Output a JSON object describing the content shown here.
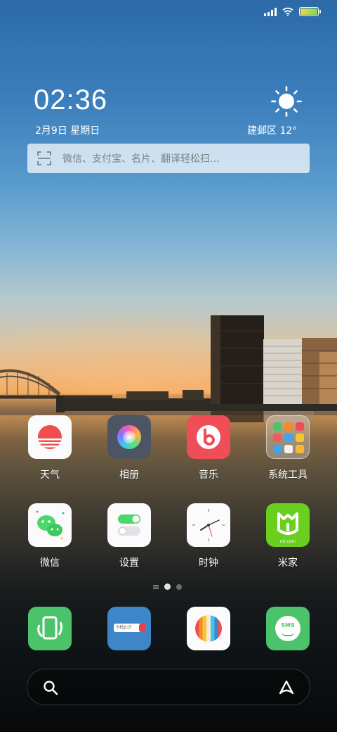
{
  "status_bar": {
    "signal_icon": "cellular-signal-icon",
    "wifi_icon": "wifi-icon",
    "battery_icon": "battery-icon"
  },
  "clock": {
    "time": "02:36",
    "date": "2月9日  星期日"
  },
  "weather": {
    "icon": "sun-icon",
    "location_temp": "建邺区  12°"
  },
  "top_search": {
    "icon": "scan-icon",
    "placeholder": "微信、支付宝、名片、翻译轻松扫..."
  },
  "apps": [
    {
      "label": "天气",
      "icon": "weather-app-icon"
    },
    {
      "label": "相册",
      "icon": "gallery-app-icon"
    },
    {
      "label": "音乐",
      "icon": "music-app-icon"
    },
    {
      "label": "系统工具",
      "icon": "system-tools-folder-icon"
    },
    {
      "label": "微信",
      "icon": "wechat-app-icon"
    },
    {
      "label": "设置",
      "icon": "settings-app-icon"
    },
    {
      "label": "时钟",
      "icon": "clock-app-icon"
    },
    {
      "label": "米家",
      "icon": "mijia-app-icon"
    }
  ],
  "mijia_caption": "mi.com",
  "browser_caption": "http://",
  "sms_caption": "SMS",
  "dock": [
    {
      "icon": "phone-app-icon"
    },
    {
      "icon": "browser-app-icon"
    },
    {
      "icon": "camera-app-icon"
    },
    {
      "icon": "messages-app-icon"
    }
  ],
  "page_indicator": {
    "pages": 2,
    "current": 1
  },
  "bottom_search": {
    "search_icon": "search-icon",
    "assistant_icon": "assistant-icon"
  },
  "colors": {
    "weather_red": "#f04e4e",
    "music_red": "#ef4d57",
    "wechat_green": "#4dd66b",
    "mijia_green": "#6bcf1f",
    "phone_green": "#4cc36a",
    "browser_blue": "#3f86c8"
  }
}
